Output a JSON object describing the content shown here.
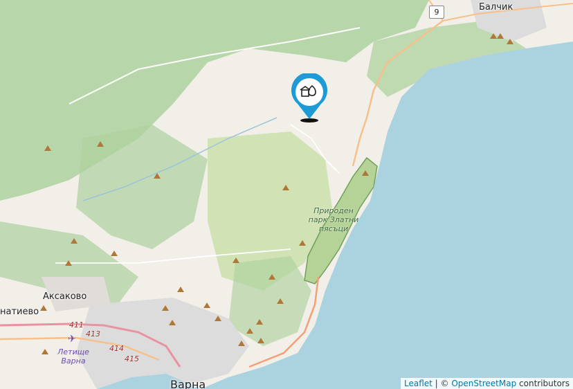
{
  "map": {
    "labels": {
      "balchik": "Балчик",
      "aksakovo": "Аксаково",
      "ignatievo": "натиево",
      "varna": "Варна",
      "park_line1": "Природен",
      "park_line2": "парк Златни",
      "park_line3": "пясъци",
      "airport_line1": "Летище",
      "airport_line2": "Варна"
    },
    "road_numbers": {
      "r9": "9",
      "r411": "411",
      "r413": "413",
      "r414": "414",
      "r415": "415"
    },
    "marker": {
      "icon": "gas-station-icon"
    },
    "colors": {
      "sea": "#aad3df",
      "land": "#f2efe9",
      "forest": "#add19e",
      "park": "#c8dfa8",
      "urban": "#dcdcdc",
      "marker": "#1e9bd7",
      "peak": "#b07838"
    }
  },
  "attribution": {
    "leaflet": "Leaflet",
    "separator": " | © ",
    "osm": "OpenStreetMap",
    "suffix": " contributors"
  }
}
